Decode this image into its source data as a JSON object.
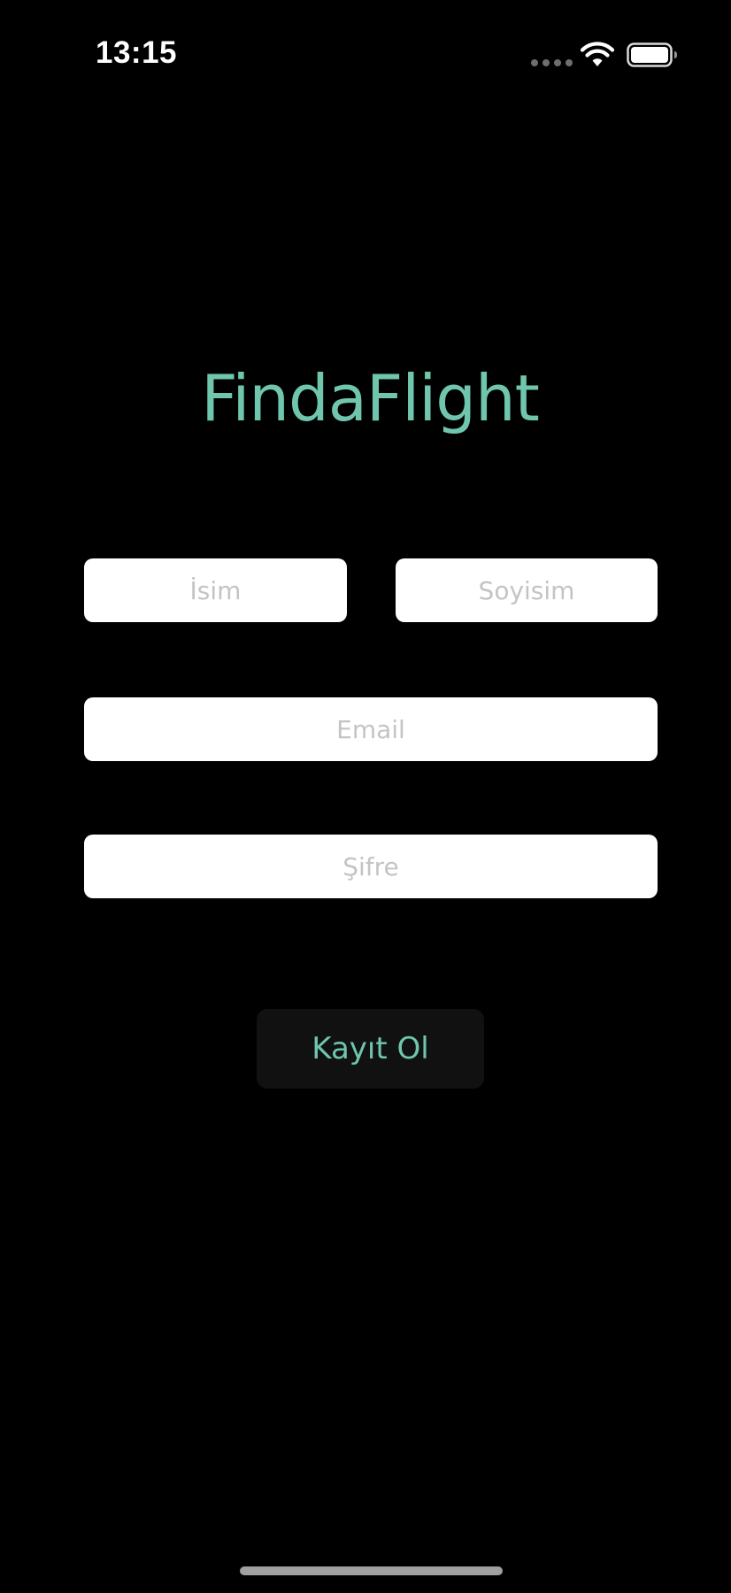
{
  "status_bar": {
    "time": "13:15",
    "icons": [
      "cellular-signal-icon",
      "wifi-icon",
      "battery-icon"
    ]
  },
  "app": {
    "title": "FindaFlight"
  },
  "form": {
    "name_placeholder": "İsim",
    "surname_placeholder": "Soyisim",
    "email_placeholder": "Email",
    "password_placeholder": "Şifre",
    "register_label": "Kayıt Ol"
  },
  "colors": {
    "background": "#000000",
    "accent": "#6fc6ad",
    "field_background": "#ffffff",
    "placeholder": "#c4c4c6",
    "button_background": "#111112"
  }
}
